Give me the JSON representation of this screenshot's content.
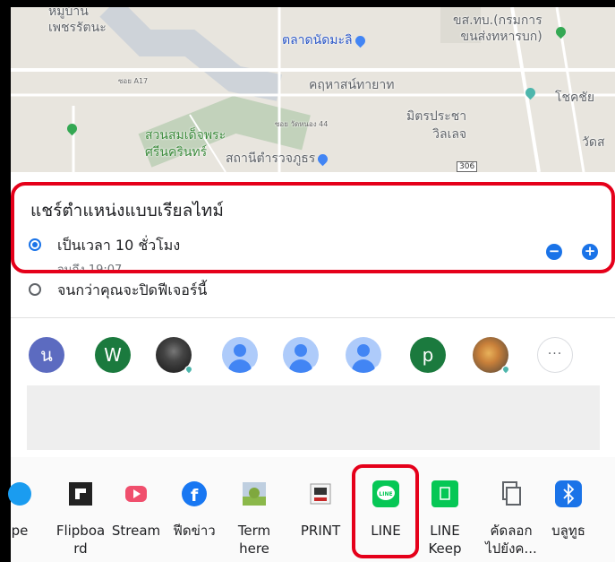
{
  "map": {
    "labels": {
      "village": "หมู่บ้าน\nเพชรรัตนะ",
      "market": "ตลาดนัดมะลิ",
      "club": "ขส.ทบ.(กรมการ\nขนส่งทหารบก)",
      "soi": "ซอย A17",
      "kukha": "คฤหาสน์ทายาท",
      "chokchai": "โชคชัย",
      "park": "สวนสมเด็จพระ\nศรีนครินทร์",
      "mit": "มิตรประชา\nวิลเลจ",
      "wat": "วัดส",
      "station": "สถานีตำรวจภูธร",
      "soi_small": "ซอย วัดหนอง 44",
      "road": "306"
    }
  },
  "share": {
    "title": "แชร์ตำแหน่งแบบเรียลไทม์",
    "option1_label": "เป็นเวลา 10 ชั่วโมง",
    "option1_sub": "จนถึง 19:07",
    "option2_label": "จนกว่าคุณจะปิดฟีเจอร์นี้",
    "minus": "−",
    "plus": "+"
  },
  "contacts": [
    {
      "type": "letter",
      "letter": "น",
      "color": "#5c6bc0"
    },
    {
      "type": "letter",
      "letter": "W",
      "color": "#1b7a3e"
    },
    {
      "type": "photo"
    },
    {
      "type": "person"
    },
    {
      "type": "person"
    },
    {
      "type": "person"
    },
    {
      "type": "letter",
      "letter": "p",
      "color": "#1b7a3e"
    },
    {
      "type": "photo"
    },
    {
      "type": "more",
      "label": "···"
    }
  ],
  "apps": [
    {
      "label": "pe",
      "icon": "skype-icon",
      "color": "#1a9cf0"
    },
    {
      "label": "Flipboa\nrd",
      "icon": "flipboard-icon",
      "color": "#222222"
    },
    {
      "label": "Stream",
      "icon": "stream-icon",
      "color": "#f04f6d"
    },
    {
      "label": "ฟีดข่าว",
      "icon": "facebook-icon",
      "color": "#1877f2"
    },
    {
      "label": "Term\nhere",
      "icon": "terminal-icon",
      "color": "#8bb84a"
    },
    {
      "label": "PRINT",
      "icon": "print-icon",
      "color": "#c62828"
    },
    {
      "label": "LINE",
      "icon": "line-icon",
      "color": "#06c755",
      "icon_text": "LINE"
    },
    {
      "label": "LINE\nKeep",
      "icon": "line-keep-icon",
      "color": "#06c755"
    },
    {
      "label": "คัดลอก\nไปยังค...",
      "icon": "copy-icon",
      "color": "#5f6368"
    },
    {
      "label": "บลูทูธ",
      "icon": "bluetooth-icon",
      "color": "#1a73e8"
    }
  ]
}
